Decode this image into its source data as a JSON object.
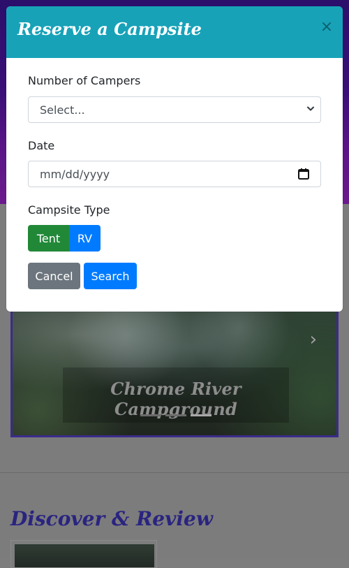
{
  "background_page": {
    "hero_caption": "Chrome River Campground",
    "section_title": "Discover & Review",
    "next_glyph": "›"
  },
  "modal": {
    "title": "Reserve a Campsite",
    "close_glyph": "×",
    "fields": {
      "campers_label": "Number of Campers",
      "campers_value": "Select...",
      "date_label": "Date",
      "date_value": "mm/dd/yyyy",
      "type_label": "Campsite Type"
    },
    "type_options": [
      "Tent",
      "RV"
    ],
    "actions": {
      "cancel_label": "Cancel",
      "search_label": "Search"
    }
  },
  "colors": {
    "modal_header": "#17a2b8",
    "tent_button": "#218838",
    "primary": "#007bff",
    "secondary": "#6c757d"
  },
  "icons": {
    "select_indicator": "chevron-down-icon",
    "date_indicator": "calendar-icon",
    "close": "close-icon",
    "carousel_next": "chevron-right-icon"
  }
}
